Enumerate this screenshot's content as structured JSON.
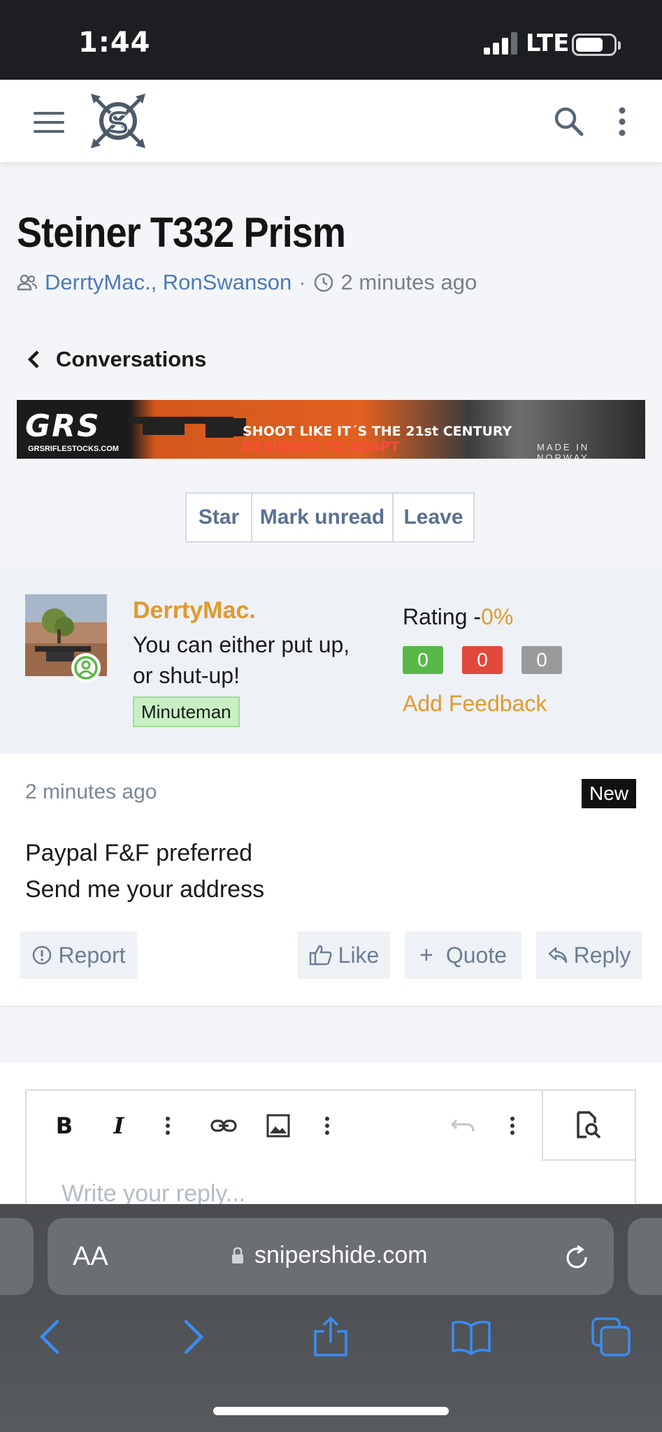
{
  "status_bar": {
    "time": "1:44",
    "network": "LTE"
  },
  "header": {
    "menu_icon": "hamburger-icon",
    "logo": "sniper-logo",
    "search_icon": "search-icon",
    "more_icon": "vertical-dots-icon"
  },
  "thread": {
    "title": "Steiner T332 Prism",
    "participants": "DerrtyMac., RonSwanson",
    "separator": "·",
    "time": "2 minutes ago",
    "back_link": "Conversations"
  },
  "banner": {
    "brand": "GRS",
    "url": "GRSRIFLESTOCKS.COM",
    "tagline_1": "SHOOT LIKE IT´S THE 21st CENTURY",
    "tagline_2": "DESIGNED TO ADAPT",
    "made_in": "MADE IN NORWAY"
  },
  "actions": {
    "star": "Star",
    "mark_unread": "Mark unread",
    "leave": "Leave"
  },
  "message": {
    "username": "DerrtyMac.",
    "user_title": "You can either put up, or shut-up!",
    "badge": "Minuteman",
    "rating_label": "Rating -",
    "rating_value": "0%",
    "feedback": {
      "positive": "0",
      "negative": "0",
      "neutral": "0"
    },
    "add_feedback": "Add Feedback",
    "time": "2 minutes ago",
    "new_label": "New",
    "body_line_1": "Paypal F&F preferred",
    "body_line_2": "Send me your address",
    "buttons": {
      "report": "Report",
      "like": "Like",
      "quote": "Quote",
      "reply": "Reply"
    }
  },
  "editor": {
    "placeholder": "Write your reply..."
  },
  "browser": {
    "text_size": "AA",
    "url": "snipershide.com"
  },
  "colors": {
    "accent": "#e19a2e",
    "link": "#4a7ab8",
    "button_text": "#5b7091",
    "positive": "#58b847",
    "negative": "#e2483b",
    "neutral": "#9a9a9a"
  }
}
